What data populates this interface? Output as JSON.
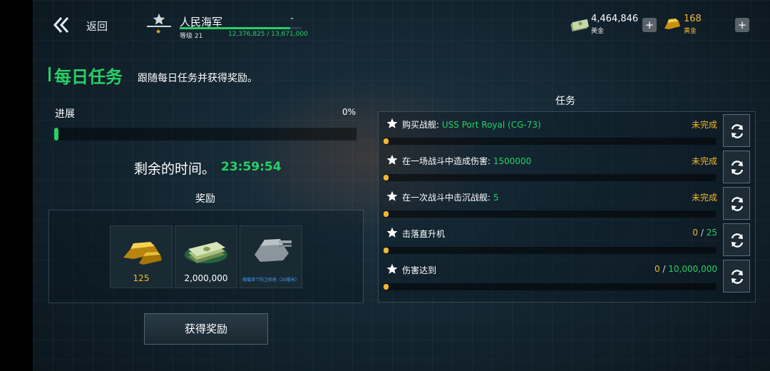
{
  "topbar": {
    "back_label": "返回",
    "player_name": "人民海军",
    "level": "等级 21",
    "xp_text": "12,376,825 / 13,671,000",
    "xp_fraction": 0.905,
    "money_value": "4,464,846",
    "money_label": "美金",
    "gold_value": "168",
    "gold_label": "黄金",
    "plus": "+"
  },
  "header": {
    "title": "每日任务",
    "subtitle": "跟随每日任务并获得奖励。"
  },
  "progress": {
    "label": "进展",
    "percent_text": "0%",
    "fraction": 0.0
  },
  "timer": {
    "label": "剩余的时间。",
    "value": "23:59:54"
  },
  "rewards": {
    "title": "奖励",
    "items": [
      {
        "icon": "gold-bars-icon",
        "value": "125"
      },
      {
        "icon": "cash-stack-icon",
        "value": "2,000,000"
      },
      {
        "icon": "turret-icon",
        "value": "舰载单个防卫机枪（20毫米）"
      }
    ],
    "claim_label": "获得奖励"
  },
  "tasks": {
    "title": "任务",
    "items": [
      {
        "label": "购买战舰: ",
        "highlight": "USS Port Royal (CG-73)",
        "status": "未完成",
        "progress": 0
      },
      {
        "label": "在一场战斗中造成伤害: ",
        "highlight": "1500000",
        "status": "未完成",
        "progress": 0
      },
      {
        "label": "在一次战斗中击沉战舰: ",
        "highlight": "5",
        "status": "未完成",
        "progress": 0
      },
      {
        "label": "击落直升机",
        "highlight": "",
        "status_current": "0",
        "status_sep": " / ",
        "status_target": "25",
        "progress": 0
      },
      {
        "label": "伤害达到",
        "highlight": "",
        "status_current": "0",
        "status_sep": " / ",
        "status_target": "10,000,000",
        "progress": 0
      }
    ]
  },
  "colors": {
    "accent_green": "#27d067",
    "gold": "#f3b72f"
  }
}
